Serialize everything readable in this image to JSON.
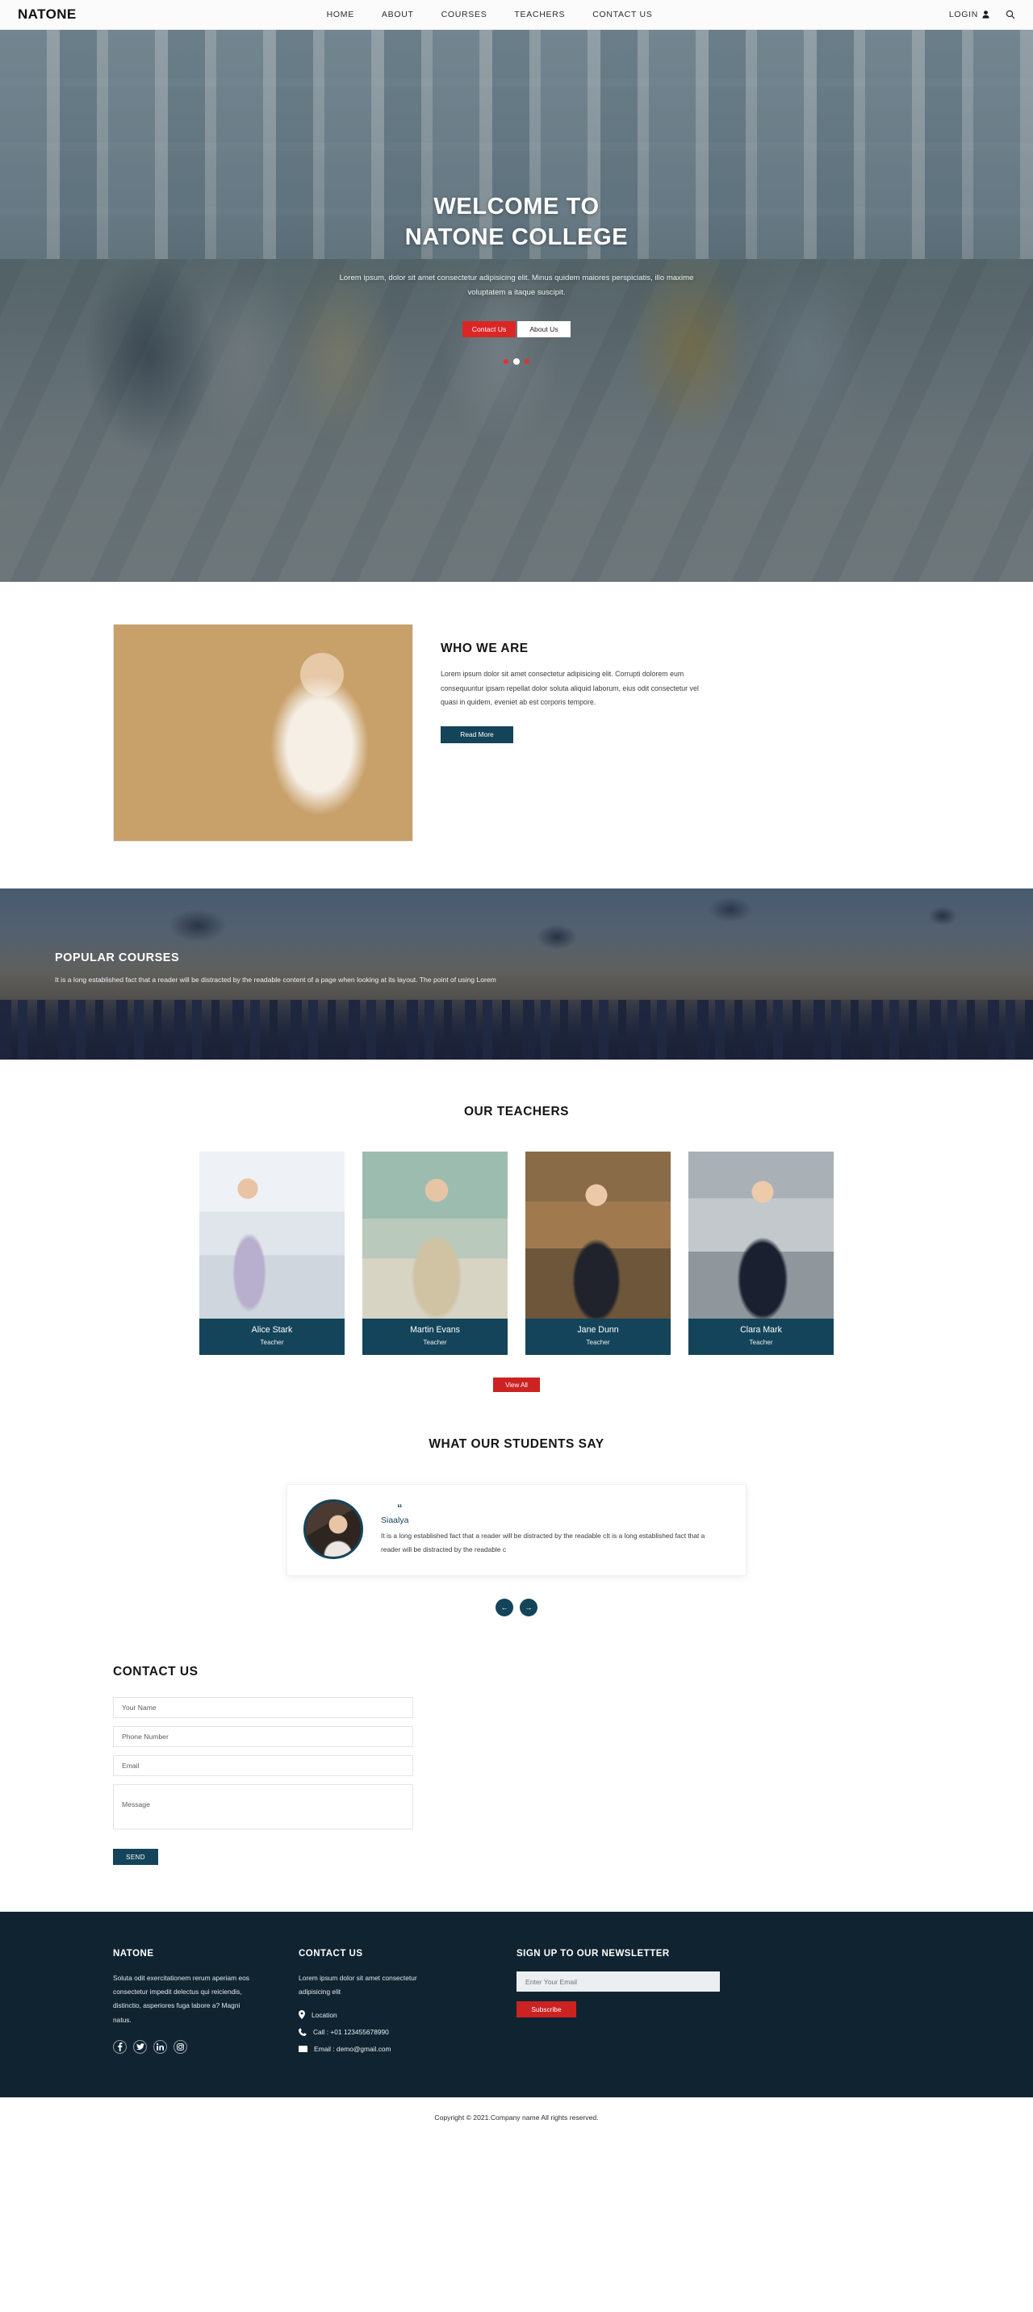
{
  "header": {
    "brand": "NATONE",
    "nav": [
      {
        "label": "HOME"
      },
      {
        "label": "ABOUT"
      },
      {
        "label": "COURSES"
      },
      {
        "label": "TEACHERS"
      },
      {
        "label": "CONTACT US"
      }
    ],
    "login_label": "LOGIN",
    "user_icon": "user-icon",
    "search_icon": "search-icon"
  },
  "hero": {
    "title_line1": "WELCOME TO",
    "title_line2": "NATONE COLLEGE",
    "subtitle": "Lorem ipsum, dolor sit amet consectetur adipisicing elit. Minus quidem maiores perspiciatis, illo maxime voluptatem a itaque suscipit.",
    "btn_primary": "Contact Us",
    "btn_secondary": "About Us",
    "dots": 3,
    "active_dot": 1,
    "dot_color": "#e03131",
    "active_dot_color": "#ffffff"
  },
  "about": {
    "title": "WHO WE ARE",
    "body": "Lorem ipsum dolor sit amet consectetur adipisicing elit. Corrupti dolorem eum consequuntur ipsam repellat dolor soluta aliquid laborum, eius odit consectetur vel quasi in quidem, eveniet ab est corporis tempore.",
    "button": "Read More"
  },
  "courses": {
    "title": "POPULAR COURSES",
    "description": "It is a long established fact that a reader will be distracted by the readable content of a page when looking at its layout. The point of using Lorem"
  },
  "teachers": {
    "title": "OUR TEACHERS",
    "items": [
      {
        "name": "Alice Stark",
        "role": "Teacher"
      },
      {
        "name": "Martin Evans",
        "role": "Teacher"
      },
      {
        "name": "Jane Dunn",
        "role": "Teacher"
      },
      {
        "name": "Clara Mark",
        "role": "Teacher"
      }
    ],
    "view_all": "View All"
  },
  "testimonials": {
    "title": "WHAT OUR STUDENTS SAY",
    "quote_glyph": "“",
    "name": "Siaalya",
    "text": "It is a long established fact that a reader will be distracted by the readable cIt is a long established fact that a reader will be distracted by the readable c",
    "prev_label": "←",
    "next_label": "→"
  },
  "contact": {
    "title": "CONTACT US",
    "name_placeholder": "Your Name",
    "phone_placeholder": "Phone Number",
    "email_placeholder": "Email",
    "message_placeholder": "Message",
    "send_label": "SEND"
  },
  "footer": {
    "brand_title": "NATONE",
    "brand_text": "Soluta odit exercitationem rerum aperiam eos consectetur impedit delectus qui reiciendis, distinctio, asperiores fuga labore a? Magni natus.",
    "socials": [
      {
        "name": "facebook-icon",
        "glyph": "f"
      },
      {
        "name": "twitter-icon",
        "glyph": "✓"
      },
      {
        "name": "linkedin-icon",
        "glyph": "in"
      },
      {
        "name": "instagram-icon",
        "glyph": "□"
      }
    ],
    "contact_title": "CONTACT US",
    "contact_text": "Lorem ipsum dolor sit amet consectetur adipisicing elit",
    "location": "Location",
    "phone": "Call : +01 123455678990",
    "email": "Email : demo@gmail.com",
    "newsletter_title": "SIGN UP TO OUR NEWSLETTER",
    "newsletter_placeholder": "Enter Your Email",
    "subscribe_label": "Subscribe"
  },
  "copyright": "Copyright © 2021.Company name All rights reserved.",
  "colors": {
    "dark": "#14445a",
    "red": "#cc2222",
    "footer_bg": "#0f2430"
  }
}
